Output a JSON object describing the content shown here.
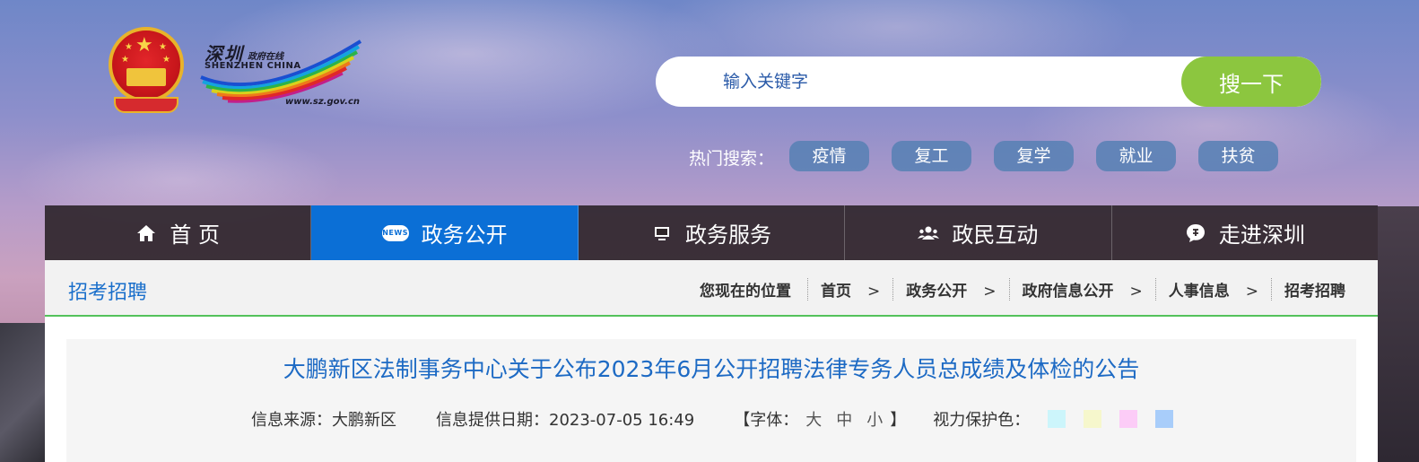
{
  "logo": {
    "emblem_icon": "national-emblem",
    "cn_name": "深圳",
    "sub_name": "政府在线",
    "en_name": "SHENZHEN  CHINA",
    "url": "www.sz.gov.cn"
  },
  "search": {
    "placeholder": "输入关键字",
    "button_label": "搜一下"
  },
  "hot_search": {
    "label": "热门搜索：",
    "tags": [
      "疫情",
      "复工",
      "复学",
      "就业",
      "扶贫"
    ]
  },
  "nav": {
    "items": [
      {
        "label": "首 页",
        "icon": "home-icon"
      },
      {
        "label": "政务公开",
        "icon": "news-icon",
        "icon_text": "NEWS"
      },
      {
        "label": "政务服务",
        "icon": "monitor-icon"
      },
      {
        "label": "政民互动",
        "icon": "people-icon"
      },
      {
        "label": "走进深圳",
        "icon": "chat-bubble-icon"
      }
    ],
    "active_index": 1
  },
  "section": {
    "title": "招考招聘",
    "breadcrumb": {
      "prefix": "您现在的位置",
      "items": [
        "首页",
        "政务公开",
        "政府信息公开",
        "人事信息",
        "招考招聘"
      ],
      "separator": ">"
    }
  },
  "article": {
    "title": "大鹏新区法制事务中心关于公布2023年6月公开招聘法律专务人员总成绩及体检的公告",
    "source": "信息来源：大鹏新区",
    "date": "信息提供日期：2023-07-05 16:49",
    "font_label_open": "【字体：",
    "font_options": [
      "大",
      "中",
      "小"
    ],
    "font_label_close": "】",
    "eye_care_label": "视力保护色：",
    "eye_care_colors": [
      "#ccf5fb",
      "#f6f7cc",
      "#fcccf7",
      "#a8cdfa"
    ]
  },
  "colors": {
    "nav_active": "#0b6fd6",
    "search_button": "#8cc63f",
    "link_blue": "#1d6ac4",
    "divider_green": "#53c25b"
  }
}
